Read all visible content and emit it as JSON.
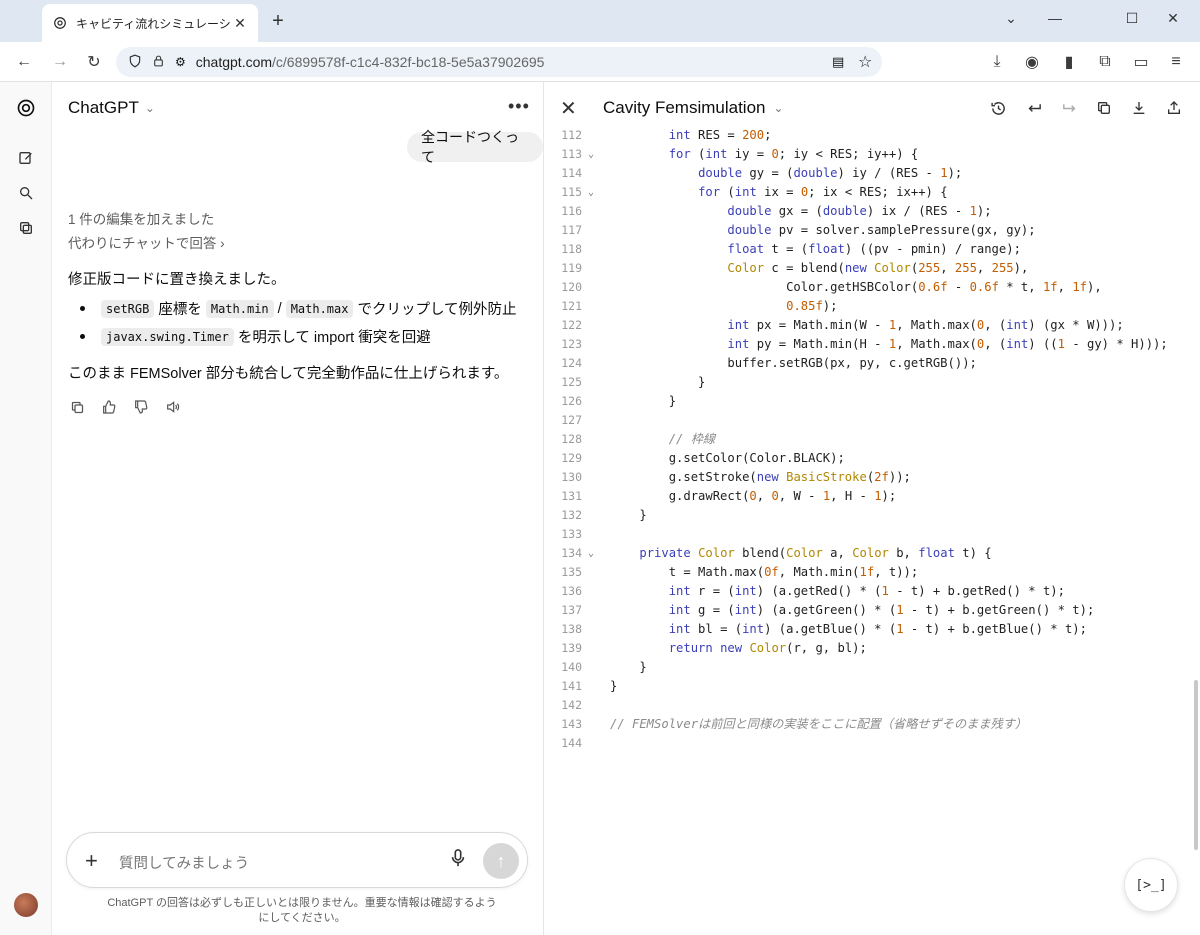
{
  "browser": {
    "tab_title": "キャビティ流れシミュレーション",
    "url_host": "chatgpt.com",
    "url_path": "/c/6899578f-c1c4-832f-bc18-5e5a37902695"
  },
  "chat": {
    "app_name": "ChatGPT",
    "user_message": "全コードつくって",
    "edit_note": "1 件の編集を加えました",
    "edit_link": "代わりにチャットで回答 ",
    "answer_intro": "修正版コードに置き換えました。",
    "bullets": [
      {
        "code1": "setRGB",
        "text1": "座標を",
        "code2": "Math.min",
        "sep": "/",
        "code3": "Math.max",
        "text2": "でクリップして例外防止"
      },
      {
        "code1": "javax.swing.Timer",
        "text1": "を明示して import 衝突を回避"
      }
    ],
    "summary": "このまま FEMSolver 部分も統合して完全動作品に仕上げられます。",
    "composer_placeholder": "質問してみましょう",
    "disclaimer": "ChatGPT の回答は必ずしも正しいとは限りません。重要な情報は確認するようにしてください。"
  },
  "canvas": {
    "title": "Cavity Femsimulation",
    "terminal_label": "[>_]",
    "lines": [
      {
        "n": "112",
        "fold": false,
        "html": "        <span class=\"kw\">int</span> RES = <span class=\"num\">200</span>;"
      },
      {
        "n": "113",
        "fold": true,
        "html": "        <span class=\"kw\">for</span> (<span class=\"kw\">int</span> iy = <span class=\"num\">0</span>; iy &lt; RES; iy++) {"
      },
      {
        "n": "114",
        "fold": false,
        "html": "            <span class=\"kw\">double</span> gy = (<span class=\"kw\">double</span>) iy / (RES - <span class=\"num\">1</span>);"
      },
      {
        "n": "115",
        "fold": true,
        "html": "            <span class=\"kw\">for</span> (<span class=\"kw\">int</span> ix = <span class=\"num\">0</span>; ix &lt; RES; ix++) {"
      },
      {
        "n": "116",
        "fold": false,
        "html": "                <span class=\"kw\">double</span> gx = (<span class=\"kw\">double</span>) ix / (RES - <span class=\"num\">1</span>);"
      },
      {
        "n": "117",
        "fold": false,
        "html": "                <span class=\"kw\">double</span> pv = solver.samplePressure(gx, gy);"
      },
      {
        "n": "118",
        "fold": false,
        "html": "                <span class=\"kw\">float</span> t = (<span class=\"kw\">float</span>) ((pv - pmin) / range);"
      },
      {
        "n": "119",
        "fold": false,
        "html": "                <span class=\"ty\">Color</span> c = blend(<span class=\"kw\">new</span> <span class=\"ty\">Color</span>(<span class=\"num\">255</span>, <span class=\"num\">255</span>, <span class=\"num\">255</span>),"
      },
      {
        "n": "120",
        "fold": false,
        "html": "                        Color.getHSBColor(<span class=\"num\">0.6f</span> - <span class=\"num\">0.6f</span> * t, <span class=\"num\">1f</span>, <span class=\"num\">1f</span>),"
      },
      {
        "n": "121",
        "fold": false,
        "html": "                        <span class=\"num\">0.85f</span>);"
      },
      {
        "n": "122",
        "fold": false,
        "html": "                <span class=\"kw\">int</span> px = Math.min(W - <span class=\"num\">1</span>, Math.max(<span class=\"num\">0</span>, (<span class=\"kw\">int</span>) (gx * W)));"
      },
      {
        "n": "123",
        "fold": false,
        "html": "                <span class=\"kw\">int</span> py = Math.min(H - <span class=\"num\">1</span>, Math.max(<span class=\"num\">0</span>, (<span class=\"kw\">int</span>) ((<span class=\"num\">1</span> - gy) * H)));"
      },
      {
        "n": "124",
        "fold": false,
        "html": "                buffer.setRGB(px, py, c.getRGB());"
      },
      {
        "n": "125",
        "fold": false,
        "html": "            }"
      },
      {
        "n": "126",
        "fold": false,
        "html": "        }"
      },
      {
        "n": "127",
        "fold": false,
        "html": ""
      },
      {
        "n": "128",
        "fold": false,
        "html": "        <span class=\"cm\">// 枠線</span>"
      },
      {
        "n": "129",
        "fold": false,
        "html": "        g.setColor(Color.BLACK);"
      },
      {
        "n": "130",
        "fold": false,
        "html": "        g.setStroke(<span class=\"kw\">new</span> <span class=\"ty\">BasicStroke</span>(<span class=\"num\">2f</span>));"
      },
      {
        "n": "131",
        "fold": false,
        "html": "        g.drawRect(<span class=\"num\">0</span>, <span class=\"num\">0</span>, W - <span class=\"num\">1</span>, H - <span class=\"num\">1</span>);"
      },
      {
        "n": "132",
        "fold": false,
        "html": "    }"
      },
      {
        "n": "133",
        "fold": false,
        "html": ""
      },
      {
        "n": "134",
        "fold": true,
        "html": "    <span class=\"kw\">private</span> <span class=\"ty\">Color</span> blend(<span class=\"ty\">Color</span> a, <span class=\"ty\">Color</span> b, <span class=\"kw\">float</span> t) {"
      },
      {
        "n": "135",
        "fold": false,
        "html": "        t = Math.max(<span class=\"num\">0f</span>, Math.min(<span class=\"num\">1f</span>, t));"
      },
      {
        "n": "136",
        "fold": false,
        "html": "        <span class=\"kw\">int</span> r = (<span class=\"kw\">int</span>) (a.getRed() * (<span class=\"num\">1</span> - t) + b.getRed() * t);"
      },
      {
        "n": "137",
        "fold": false,
        "html": "        <span class=\"kw\">int</span> g = (<span class=\"kw\">int</span>) (a.getGreen() * (<span class=\"num\">1</span> - t) + b.getGreen() * t);"
      },
      {
        "n": "138",
        "fold": false,
        "html": "        <span class=\"kw\">int</span> bl = (<span class=\"kw\">int</span>) (a.getBlue() * (<span class=\"num\">1</span> - t) + b.getBlue() * t);"
      },
      {
        "n": "139",
        "fold": false,
        "html": "        <span class=\"kw\">return</span> <span class=\"kw\">new</span> <span class=\"ty\">Color</span>(r, g, bl);"
      },
      {
        "n": "140",
        "fold": false,
        "html": "    }"
      },
      {
        "n": "141",
        "fold": false,
        "html": "}"
      },
      {
        "n": "142",
        "fold": false,
        "html": ""
      },
      {
        "n": "143",
        "fold": false,
        "html": "<span class=\"cm\">// FEMSolverは前回と同様の実装をここに配置（省略せずそのまま残す）</span>"
      },
      {
        "n": "144",
        "fold": false,
        "html": ""
      }
    ]
  }
}
